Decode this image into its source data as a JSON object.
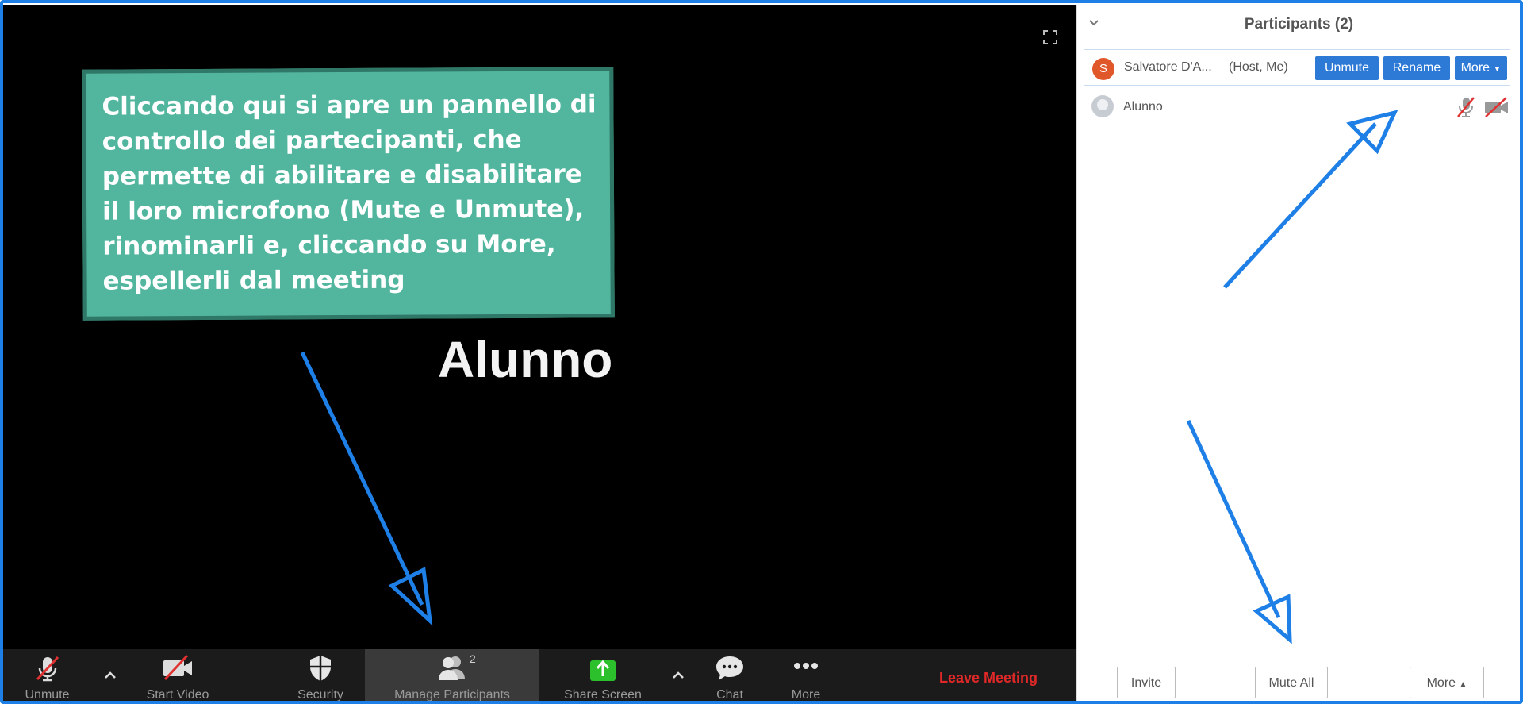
{
  "video": {
    "participant_name": "Alunno"
  },
  "callout": {
    "text": "Cliccando qui si apre un pannello di controllo dei partecipanti, che permette di abilitare e disabilitare il loro microfono (Mute e Unmute), rinominarli e, cliccando su More, espellerli dal meeting"
  },
  "toolbar": {
    "unmute": "Unmute",
    "start_video": "Start Video",
    "security": "Security",
    "manage_participants": "Manage Participants",
    "participants_count": "2",
    "share_screen": "Share Screen",
    "chat": "Chat",
    "more": "More",
    "leave": "Leave Meeting"
  },
  "panel": {
    "title": "Participants (2)",
    "host": {
      "initial": "S",
      "name": "Salvatore D'A...",
      "role": "(Host, Me)",
      "unmute": "Unmute",
      "rename": "Rename",
      "more": "More"
    },
    "participant": {
      "name": "Alunno"
    },
    "footer": {
      "invite": "Invite",
      "mute_all": "Mute All",
      "more": "More"
    }
  },
  "colors": {
    "accent": "#2d7ad6",
    "leave": "#e02828",
    "callout": "#52b69f",
    "arrow": "#1e7fe6",
    "share": "#2cc12c"
  }
}
